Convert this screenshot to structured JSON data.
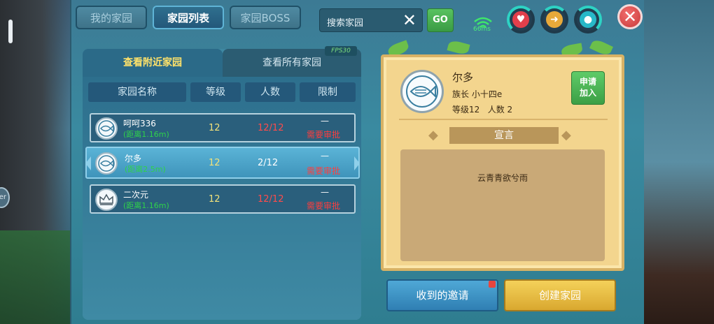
{
  "tabs": [
    "我的家园",
    "家园列表",
    "家园BOSS"
  ],
  "search": {
    "placeholder": "搜索家园",
    "go_label": "GO"
  },
  "network": {
    "ping": "66ms"
  },
  "stats": {
    "heart_icon": "heart-icon",
    "food_icon": "food-icon",
    "water_icon": "water-icon"
  },
  "list": {
    "subtabs": [
      "查看附近家园",
      "查看所有家园"
    ],
    "fps": "FPS30",
    "columns": [
      "家园名称",
      "等级",
      "人数",
      "限制"
    ],
    "rows": [
      {
        "name": "呵呵336",
        "distance": "(距离1.16m)",
        "level": "12",
        "count": "12/12",
        "limit_top": "—",
        "limit": "需要审批"
      },
      {
        "name": "尔多",
        "distance": "(距离2.5m)",
        "level": "12",
        "count": "2/12",
        "limit_top": "—",
        "limit": "需要审批"
      },
      {
        "name": "二次元",
        "distance": "(距离1.16m)",
        "level": "12",
        "count": "12/12",
        "limit_top": "—",
        "limit": "需要审批"
      }
    ]
  },
  "detail": {
    "name": "尔多",
    "leader": "族长 小十四e",
    "stats": "等级12   人数 2",
    "apply_label": "申请\n加入",
    "declaration_title": "宣言",
    "declaration_text": "云青青欲兮雨"
  },
  "buttons": {
    "invite": "收到的邀请",
    "create": "创建家园"
  }
}
